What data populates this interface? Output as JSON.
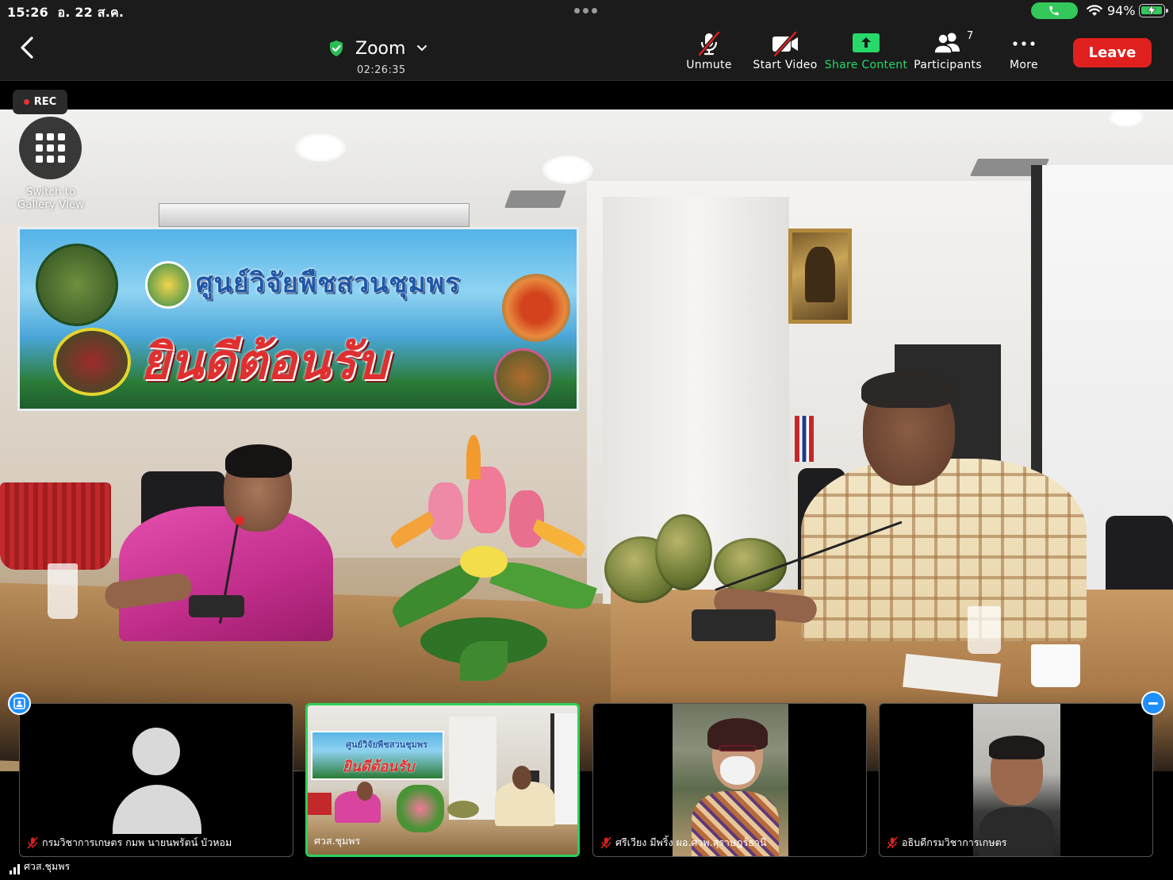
{
  "status_bar": {
    "time": "15:26",
    "date": "อ. 22 ส.ค.",
    "battery": "94%"
  },
  "toolbar": {
    "meeting_title": "Zoom",
    "elapsed_time": "02:26:35",
    "buttons": {
      "unmute": "Unmute",
      "start_video": "Start Video",
      "share_content": "Share Content",
      "participants": "Participants",
      "more": "More",
      "leave": "Leave"
    },
    "participant_count": "7",
    "colors": {
      "share": "#27d96a",
      "leave": "#e0201e",
      "secure": "#2dbb55"
    }
  },
  "main_video": {
    "rec_label": "REC",
    "gallery_button_label_1": "Switch to",
    "gallery_button_label_2": "Gallery View",
    "banner_line1": "ศูนย์วิจัยพืชสวนชุมพร",
    "banner_line2": "ยินดีต้อนรับ"
  },
  "thumbnails": [
    {
      "name": "กรมวิชาการเกษตร กมพ นายนพรัตน์ บัวหอม",
      "muted": true,
      "video": "avatar-placeholder"
    },
    {
      "name": "ศวส.ชุมพร",
      "muted": false,
      "video": "meeting-room",
      "active": true
    },
    {
      "name": "ศรีเวียง มีพริ้ง ผอ.ศวพ.สุราษฎร์ธานี",
      "muted": true,
      "video": "woman-with-mask"
    },
    {
      "name": "อธิบดีกรมวิชาการเกษตร",
      "muted": true,
      "video": "man-portrait"
    }
  ],
  "active_speaker_label": "ศวส.ชุมพร"
}
